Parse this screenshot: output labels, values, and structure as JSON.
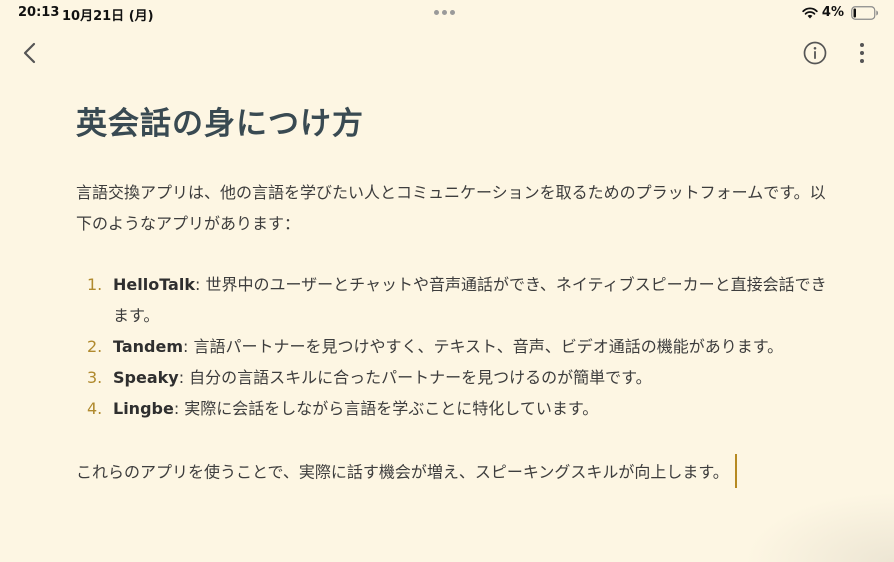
{
  "status_bar": {
    "time": "20:13",
    "date": "10月21日 (月)",
    "battery_percent": "4%",
    "wifi_icon": "wifi-icon",
    "battery_icon": "battery-low-icon"
  },
  "nav": {
    "back_icon": "chevron-left-icon",
    "info_icon": "info-circle-icon",
    "more_icon": "vertical-ellipsis-icon"
  },
  "document": {
    "title": "英会話の身につけ方",
    "intro": "言語交換アプリは、他の言語を学びたい人とコミュニケーションを取るためのプラットフォームです。以下のようなアプリがあります：",
    "apps": [
      {
        "number": "1.",
        "name": "HelloTalk",
        "description": ": 世界中のユーザーとチャットや音声通話ができ、ネイティブスピーカーと直接会話できます。"
      },
      {
        "number": "2.",
        "name": "Tandem",
        "description": ": 言語パートナーを見つけやすく、テキスト、音声、ビデオ通話の機能があります。"
      },
      {
        "number": "3.",
        "name": "Speaky",
        "description": ": 自分の言語スキルに合ったパートナーを見つけるのが簡単です。"
      },
      {
        "number": "4.",
        "name": "Lingbe",
        "description": ": 実際に会話をしながら言語を学ぶことに特化しています。"
      }
    ],
    "outro": "これらのアプリを使うことで、実際に話す機会が増え、スピーキングスキルが向上します。"
  },
  "colors": {
    "background": "#fdf6e3",
    "title": "#394a52",
    "list_number": "#b08a2e",
    "cursor": "#b68a22"
  }
}
